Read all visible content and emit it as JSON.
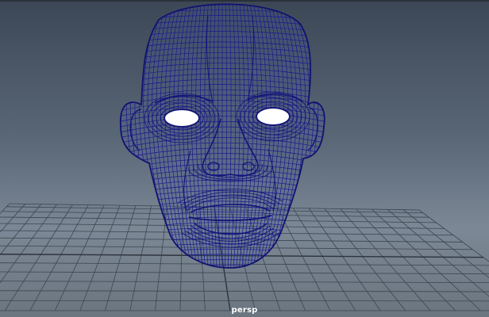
{
  "viewport": {
    "camera_label": "persp"
  },
  "colors": {
    "background_top": "#3c4756",
    "background_bottom": "#6b7580",
    "wireframe": "#1a1a8c",
    "grid": "#3d4650",
    "grid_axis": "#2c333b",
    "label": "#ffffff"
  },
  "scene": {
    "object": "head-mesh",
    "display_mode": "wireframe",
    "grid_visible": true
  }
}
